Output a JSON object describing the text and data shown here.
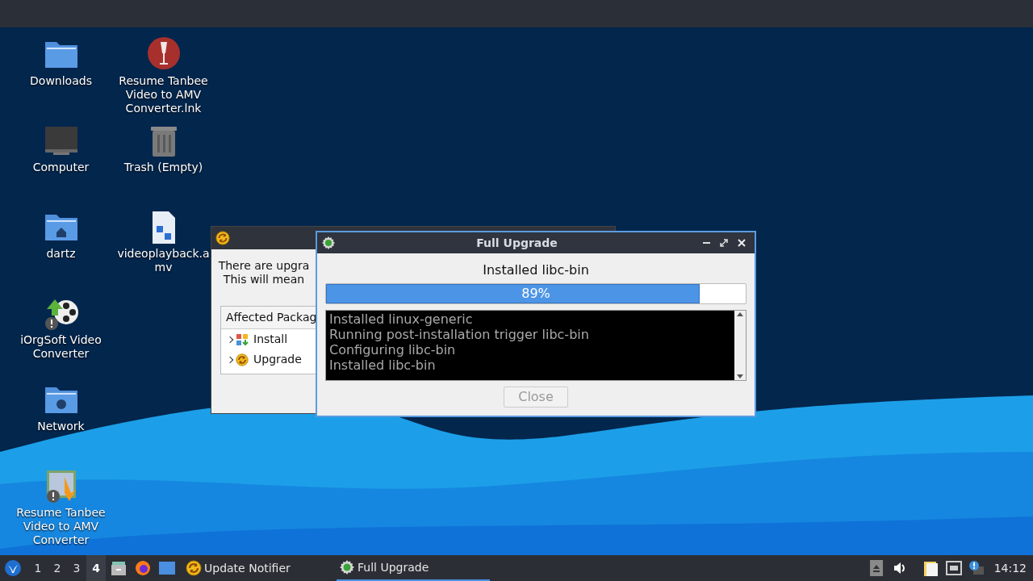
{
  "desktop": {
    "icon_columns": [
      [
        {
          "label": "Downloads",
          "kind": "folder"
        },
        {
          "label": "Computer",
          "kind": "computer"
        },
        {
          "label": "dartz",
          "kind": "home"
        },
        {
          "label": "iOrgSoft Video Converter",
          "kind": "reel"
        },
        {
          "label": "Network",
          "kind": "network"
        },
        {
          "label": "Resume Tanbee Video to AMV Converter",
          "kind": "app"
        }
      ],
      [
        {
          "label": "Resume Tanbee Video to AMV Converter.lnk",
          "kind": "wine"
        },
        {
          "label": "Trash (Empty)",
          "kind": "trash"
        },
        {
          "label": "videoplayback.amv",
          "kind": "file"
        }
      ]
    ]
  },
  "update_notifier": {
    "lines": [
      "There are upgra",
      "This will mean"
    ],
    "tree_header": "Affected Packag",
    "items": [
      {
        "label": "Install",
        "kind": "install",
        "expanded": false
      },
      {
        "label": "Upgrade",
        "kind": "upgrade",
        "expanded": false
      }
    ]
  },
  "full_upgrade": {
    "title": "Full Upgrade",
    "status": "Installed libc-bin",
    "level": 0.89,
    "reading": "89%",
    "log": [
      "Installed linux-generic",
      "Running post-installation trigger libc-bin",
      "Configuring libc-bin",
      "Installed libc-bin"
    ],
    "close": {
      "label": "Close",
      "disabled": true
    }
  },
  "taskbar": {
    "workspaces": [
      {
        "label": "1",
        "selected": false
      },
      {
        "label": "2",
        "selected": false
      },
      {
        "label": "3",
        "selected": false
      },
      {
        "label": "4",
        "selected": true
      }
    ],
    "tasks": [
      {
        "label": "Update Notifier",
        "kind": "upgrade",
        "selected": false
      },
      {
        "label": "Full Upgrade",
        "kind": "gear",
        "selected": true
      }
    ],
    "clock": "14:12"
  }
}
